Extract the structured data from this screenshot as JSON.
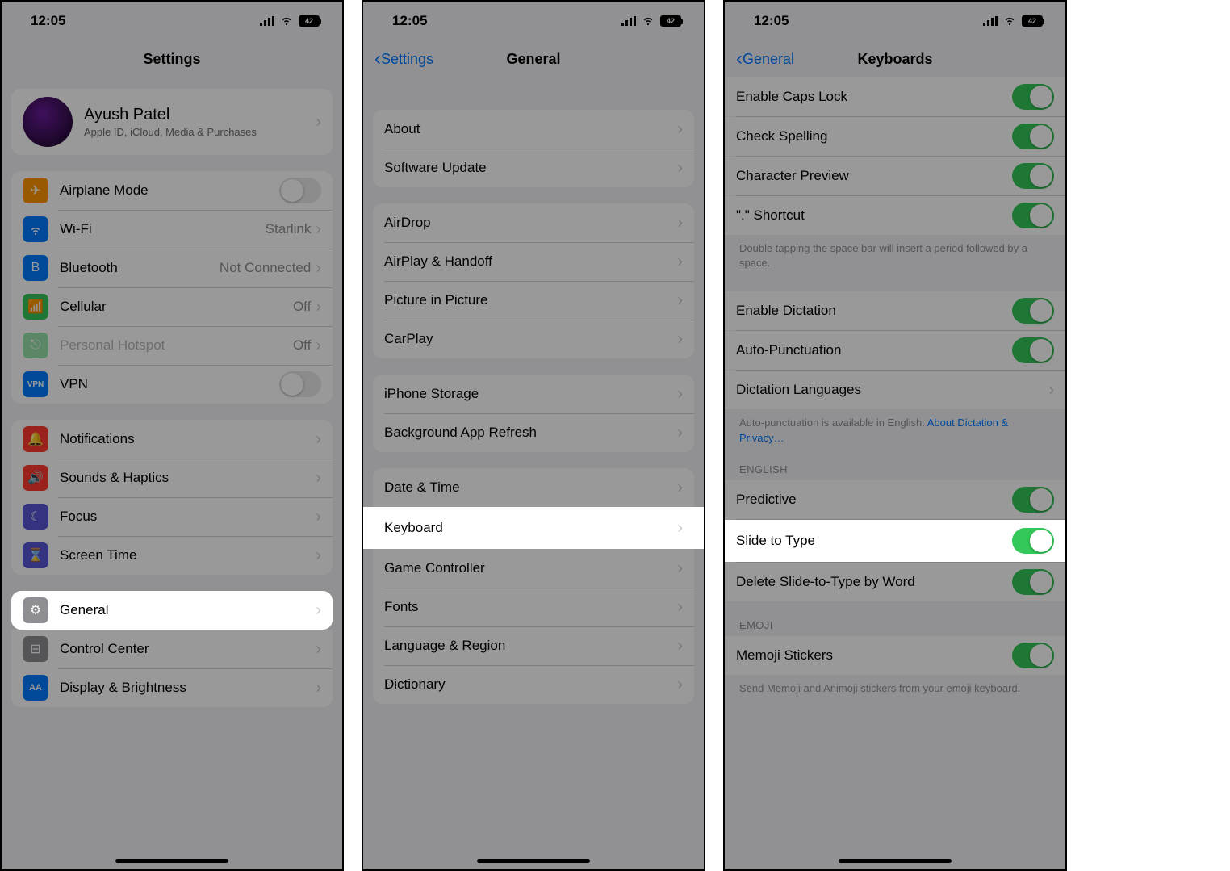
{
  "status": {
    "time": "12:05",
    "battery": "42"
  },
  "screen1": {
    "title": "Settings",
    "profile": {
      "name": "Ayush Patel",
      "sub": "Apple ID, iCloud, Media & Purchases"
    },
    "rows": {
      "airplane": "Airplane Mode",
      "wifi": "Wi-Fi",
      "wifi_val": "Starlink",
      "bluetooth": "Bluetooth",
      "bluetooth_val": "Not Connected",
      "cellular": "Cellular",
      "cellular_val": "Off",
      "hotspot": "Personal Hotspot",
      "hotspot_val": "Off",
      "vpn": "VPN",
      "notifications": "Notifications",
      "sounds": "Sounds & Haptics",
      "focus": "Focus",
      "screentime": "Screen Time",
      "general": "General",
      "controlcenter": "Control Center",
      "display": "Display & Brightness"
    }
  },
  "screen2": {
    "back": "Settings",
    "title": "General",
    "rows": {
      "about": "About",
      "software": "Software Update",
      "airdrop": "AirDrop",
      "airplay": "AirPlay & Handoff",
      "pip": "Picture in Picture",
      "carplay": "CarPlay",
      "storage": "iPhone Storage",
      "refresh": "Background App Refresh",
      "datetime": "Date & Time",
      "keyboard": "Keyboard",
      "gamectrl": "Game Controller",
      "fonts": "Fonts",
      "lang": "Language & Region",
      "dict": "Dictionary"
    }
  },
  "screen3": {
    "back": "General",
    "title": "Keyboards",
    "rows": {
      "caps": "Enable Caps Lock",
      "spell": "Check Spelling",
      "charprev": "Character Preview",
      "shortcut": "\".\" Shortcut",
      "shortcut_hint": "Double tapping the space bar will insert a period followed by a space.",
      "dictation": "Enable Dictation",
      "autopunc": "Auto-Punctuation",
      "dictlang": "Dictation Languages",
      "dict_hint": "Auto-punctuation is available in English. ",
      "dict_link": "About Dictation & Privacy…",
      "section_english": "ENGLISH",
      "predictive": "Predictive",
      "slide": "Slide to Type",
      "delslide": "Delete Slide-to-Type by Word",
      "section_emoji": "EMOJI",
      "memoji": "Memoji Stickers",
      "memoji_hint": "Send Memoji and Animoji stickers from your emoji keyboard."
    }
  }
}
